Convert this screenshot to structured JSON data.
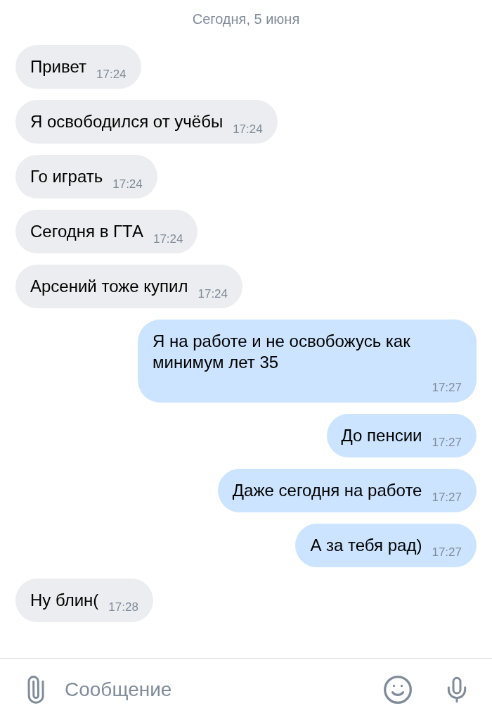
{
  "date": "Сегодня, 5 июня",
  "messages": [
    {
      "kind": "incoming",
      "text": "Привет",
      "time": "17:24"
    },
    {
      "kind": "incoming",
      "text": "Я освободился от учёбы",
      "time": "17:24"
    },
    {
      "kind": "incoming",
      "text": "Го играть",
      "time": "17:24"
    },
    {
      "kind": "incoming",
      "text": "Сегодня в ГТА",
      "time": "17:24"
    },
    {
      "kind": "incoming",
      "text": "Арсений тоже купил",
      "time": "17:24"
    },
    {
      "kind": "outgoing",
      "text": "Я на работе и не освобожусь как минимум лет 35",
      "time": "17:27"
    },
    {
      "kind": "outgoing",
      "text": "До пенсии",
      "time": "17:27"
    },
    {
      "kind": "outgoing",
      "text": "Даже сегодня на работе",
      "time": "17:27"
    },
    {
      "kind": "outgoing",
      "text": "А за тебя рад)",
      "time": "17:27"
    },
    {
      "kind": "incoming",
      "text": "Ну блин(",
      "time": "17:28"
    }
  ],
  "composer": {
    "placeholder": "Сообщение"
  }
}
